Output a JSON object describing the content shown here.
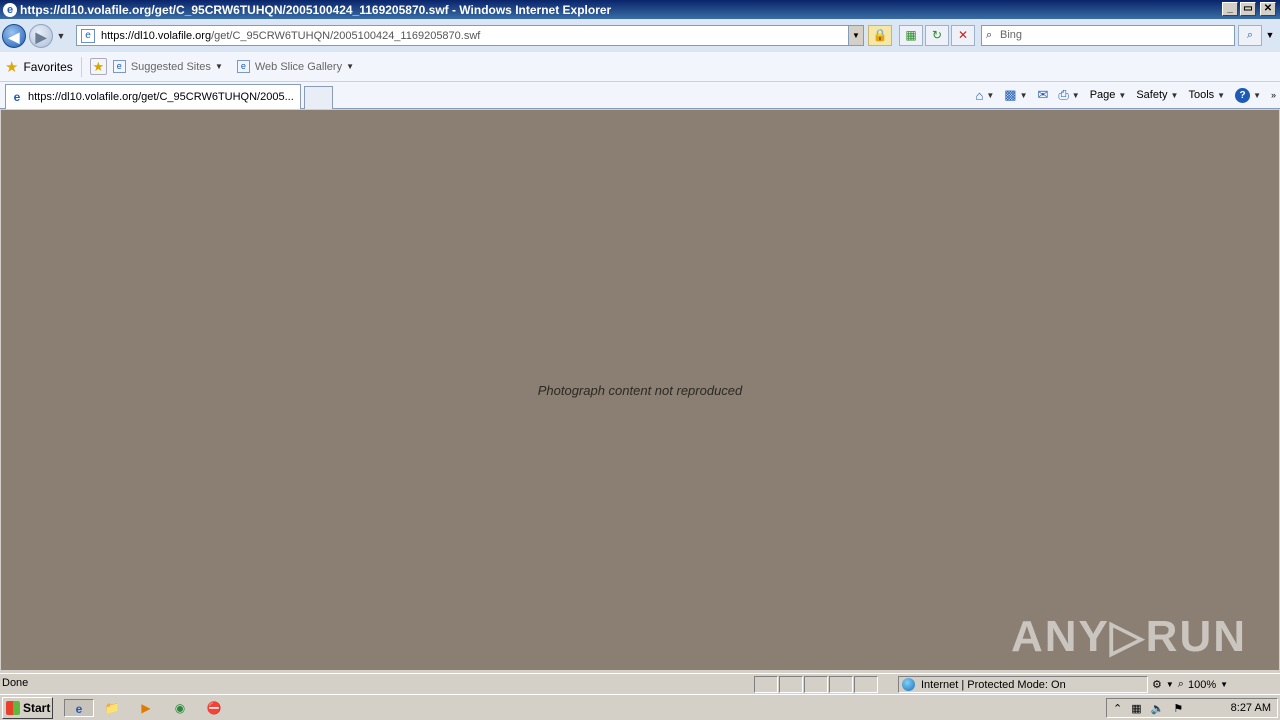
{
  "window": {
    "title": "https://dl10.volafile.org/get/C_95CRW6TUHQN/2005100424_1169205870.swf - Windows Internet Explorer",
    "controls": [
      "_",
      "▭",
      "✕"
    ]
  },
  "navbar": {
    "url_host": "https://dl10.volafile.org",
    "url_path": "/get/C_95CRW6TUHQN/2005100424_1169205870.swf",
    "search_placeholder": "Bing"
  },
  "favorites": {
    "label": "Favorites",
    "items": [
      {
        "label": "Suggested Sites"
      },
      {
        "label": "Web Slice Gallery"
      }
    ]
  },
  "tabs": [
    {
      "label": "https://dl10.volafile.org/get/C_95CRW6TUHQN/2005..."
    }
  ],
  "command_bar": {
    "page": "Page",
    "safety": "Safety",
    "tools": "Tools"
  },
  "content": {
    "note": "Photograph content not reproduced",
    "watermark": "ANY▷RUN"
  },
  "statusbar": {
    "text": "Done",
    "zone": "Internet | Protected Mode: On",
    "zoom": "100%"
  },
  "taskbar": {
    "start": "Start",
    "clock": "8:27 AM"
  },
  "colors": {
    "title_bar": "#0a246a",
    "chrome": "#d4d0c8",
    "nav_bar": "#dbe6f5"
  }
}
